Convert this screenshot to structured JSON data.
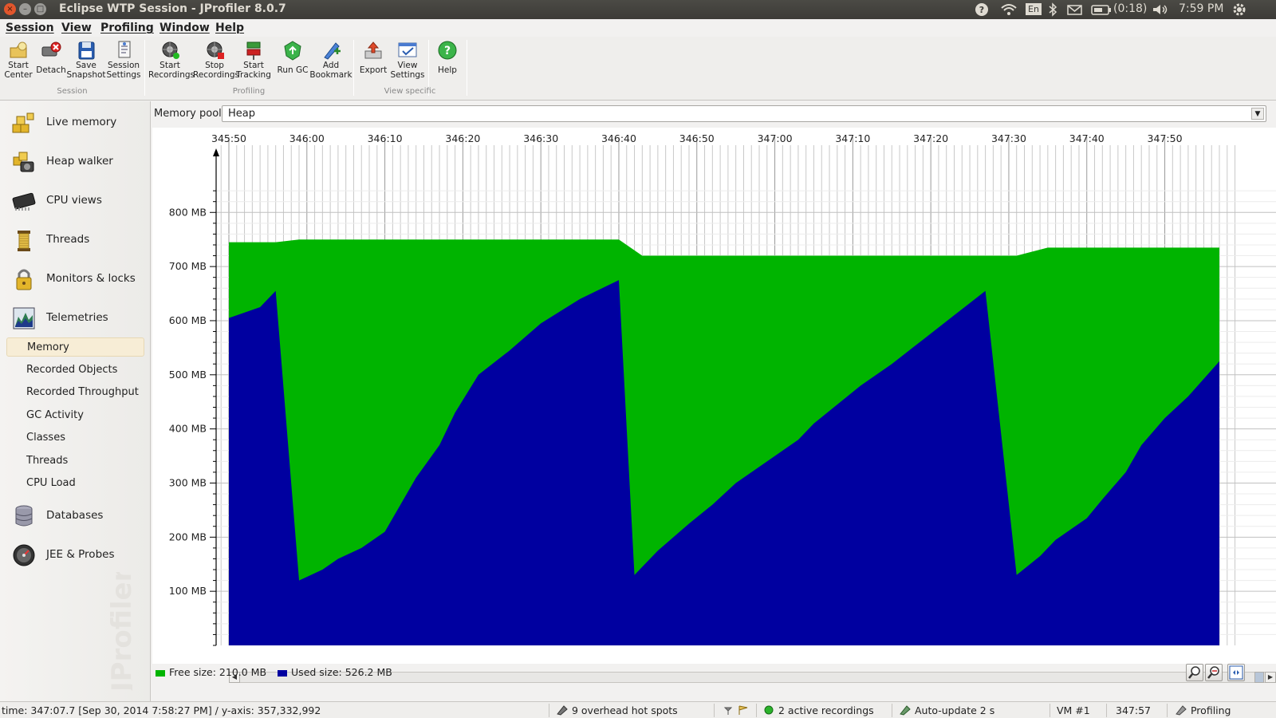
{
  "window": {
    "title": "Eclipse WTP Session - JProfiler 8.0.7",
    "tray": {
      "language": "En",
      "battery": "(0:18)",
      "clock": "7:59 PM"
    }
  },
  "menu": [
    "Session",
    "View",
    "Profiling",
    "Window",
    "Help"
  ],
  "toolbar": {
    "buttons": [
      {
        "line1": "Start",
        "line2": "Center",
        "icon": "start-center-icon"
      },
      {
        "line1": "Detach",
        "line2": "",
        "icon": "detach-icon"
      },
      {
        "line1": "Save",
        "line2": "Snapshot",
        "icon": "save-snapshot-icon"
      },
      {
        "line1": "Session",
        "line2": "Settings",
        "icon": "session-settings-icon"
      },
      {
        "line1": "Start",
        "line2": "Recordings",
        "icon": "start-recordings-icon"
      },
      {
        "line1": "Stop",
        "line2": "Recordings",
        "icon": "stop-recordings-icon"
      },
      {
        "line1": "Start",
        "line2": "Tracking",
        "icon": "start-tracking-icon"
      },
      {
        "line1": "Run GC",
        "line2": "",
        "icon": "run-gc-icon"
      },
      {
        "line1": "Add",
        "line2": "Bookmark",
        "icon": "add-bookmark-icon"
      },
      {
        "line1": "Export",
        "line2": "",
        "icon": "export-icon"
      },
      {
        "line1": "View",
        "line2": "Settings",
        "icon": "view-settings-icon"
      },
      {
        "line1": "Help",
        "line2": "",
        "icon": "help-icon"
      }
    ],
    "groups": [
      "Session",
      "Profiling",
      "View specific"
    ]
  },
  "sidebar": {
    "sections": [
      {
        "label": "Live memory",
        "icon": "live-memory-icon"
      },
      {
        "label": "Heap walker",
        "icon": "heap-walker-icon"
      },
      {
        "label": "CPU views",
        "icon": "cpu-views-icon"
      },
      {
        "label": "Threads",
        "icon": "threads-icon"
      },
      {
        "label": "Monitors & locks",
        "icon": "monitors-locks-icon"
      },
      {
        "label": "Telemetries",
        "icon": "telemetries-icon"
      },
      {
        "label": "Databases",
        "icon": "databases-icon"
      },
      {
        "label": "JEE & Probes",
        "icon": "jee-probes-icon"
      }
    ],
    "telemetry_items": [
      "Memory",
      "Recorded Objects",
      "Recorded Throughput",
      "GC Activity",
      "Classes",
      "Threads",
      "CPU Load"
    ],
    "selected": "Memory",
    "watermark": "JProfiler"
  },
  "main": {
    "pool_label": "Memory pool:",
    "pool_value": "Heap"
  },
  "legend": {
    "free": "Free size: 210.0 MB",
    "used": "Used size: 526.2 MB"
  },
  "colors": {
    "free": "#00b400",
    "used": "#0000a0"
  },
  "chart_data": {
    "type": "area",
    "stacked": true,
    "x_tick_labels": [
      "345:50",
      "346:00",
      "346:10",
      "346:20",
      "346:30",
      "346:40",
      "346:50",
      "347:00",
      "347:10",
      "347:20",
      "347:30",
      "347:40",
      "347:50"
    ],
    "y_tick_labels": [
      "800 MB",
      "700 MB",
      "600 MB",
      "500 MB",
      "400 MB",
      "300 MB",
      "200 MB",
      "100 MB"
    ],
    "ylim": [
      0,
      800
    ],
    "xlim_seconds": [
      20750,
      20878
    ],
    "x_label_start_seconds": 20750,
    "x_label_step_seconds": 10,
    "grid": true,
    "series": [
      {
        "name": "Used size",
        "x": [
          20750,
          20754,
          20756,
          20759,
          20762,
          20764,
          20767,
          20770,
          20772,
          20774,
          20777,
          20779,
          20782,
          20786,
          20790,
          20795,
          20800,
          20802,
          20805,
          20809,
          20812,
          20815,
          20819,
          20823,
          20825,
          20828,
          20831,
          20835,
          20839,
          20843,
          20847,
          20851,
          20854,
          20856,
          20860,
          20862,
          20865,
          20867,
          20870,
          20873,
          20877
        ],
        "values": [
          605,
          625,
          655,
          120,
          140,
          160,
          180,
          210,
          260,
          310,
          370,
          430,
          500,
          545,
          595,
          640,
          675,
          130,
          175,
          225,
          260,
          300,
          340,
          380,
          410,
          445,
          480,
          520,
          565,
          610,
          655,
          130,
          165,
          195,
          235,
          270,
          320,
          370,
          420,
          460,
          525
        ]
      },
      {
        "name": "Free size",
        "x": [
          20750,
          20756,
          20759,
          20762,
          20800,
          20803,
          20823,
          20851,
          20855,
          20877
        ],
        "values": [
          745,
          745,
          750,
          750,
          750,
          720,
          720,
          720,
          735,
          735
        ],
        "note_total_heap": true
      }
    ]
  },
  "statusbar": {
    "position": "time: 347:07.7 [Sep 30, 2014 7:58:27 PM]  /  y-axis: 357,332,992",
    "hotspots": "9 overhead hot spots",
    "recordings": "2 active recordings",
    "autoupdate": "Auto-update 2 s",
    "vm": "VM #1",
    "elapsed": "347:57",
    "mode": "Profiling"
  }
}
